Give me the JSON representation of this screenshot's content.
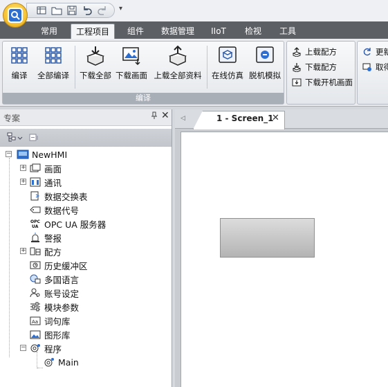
{
  "ribbon_tabs": [
    {
      "label": "常用",
      "active": false
    },
    {
      "label": "工程项目",
      "active": true
    },
    {
      "label": "组件",
      "active": false
    },
    {
      "label": "数据管理",
      "active": false
    },
    {
      "label": "IIoT",
      "active": false
    },
    {
      "label": "检视",
      "active": false
    },
    {
      "label": "工具",
      "active": false
    }
  ],
  "quick_access": {
    "icons": [
      "new-project-icon",
      "open-folder-icon",
      "save-icon",
      "undo-icon",
      "redo-icon",
      "customize-dropdown-icon"
    ]
  },
  "ribbon": {
    "build_group": {
      "label": "编译",
      "buttons": [
        {
          "label": "编译",
          "icon": "compile-icon"
        },
        {
          "label": "全部编译",
          "icon": "compile-all-icon"
        },
        {
          "label": "下载全部",
          "icon": "download-all-icon"
        },
        {
          "label": "下载画面",
          "icon": "download-screen-icon"
        },
        {
          "label": "上载全部资料",
          "icon": "upload-all-icon"
        },
        {
          "label": "在线仿真",
          "icon": "online-simulation-icon"
        },
        {
          "label": "脱机模拟",
          "icon": "offline-simulation-icon"
        }
      ]
    },
    "recipe_group": {
      "buttons": [
        {
          "label": "上载配方",
          "icon": "upload-recipe-icon"
        },
        {
          "label": "下载配方",
          "icon": "download-recipe-icon"
        },
        {
          "label": "下载开机画面",
          "icon": "download-startup-screen-icon"
        }
      ]
    },
    "update_group": {
      "buttons": [
        {
          "label": "更新",
          "icon": "update-icon"
        },
        {
          "label": "取得",
          "icon": "get-icon"
        }
      ]
    }
  },
  "project_panel": {
    "title": "专案",
    "pin": "ㅁ",
    "close": "✕",
    "tree": {
      "root": "NewHMI",
      "items": [
        {
          "label": "画面",
          "icon": "screen-icon",
          "expandable": true
        },
        {
          "label": "通讯",
          "icon": "communication-icon",
          "expandable": true
        },
        {
          "label": "数据交换表",
          "icon": "data-exchange-icon",
          "expandable": false
        },
        {
          "label": "数据代号",
          "icon": "tag-icon",
          "expandable": false
        },
        {
          "label": "OPC UA 服务器",
          "icon": "opc-ua-icon",
          "expandable": false
        },
        {
          "label": "警报",
          "icon": "alarm-icon",
          "expandable": false
        },
        {
          "label": "配方",
          "icon": "recipe-icon",
          "expandable": true
        },
        {
          "label": "历史缓冲区",
          "icon": "history-buffer-icon",
          "expandable": false
        },
        {
          "label": "多国语言",
          "icon": "multilanguage-icon",
          "expandable": false
        },
        {
          "label": "账号设定",
          "icon": "account-icon",
          "expandable": false
        },
        {
          "label": "模块参数",
          "icon": "module-params-icon",
          "expandable": false
        },
        {
          "label": "词句库",
          "icon": "text-library-icon",
          "expandable": false
        },
        {
          "label": "图形库",
          "icon": "graphics-library-icon",
          "expandable": false
        },
        {
          "label": "程序",
          "icon": "program-icon",
          "expandable": true,
          "expanded": true
        }
      ],
      "program_children": [
        {
          "label": "Main",
          "icon": "macro-icon"
        }
      ]
    }
  },
  "document": {
    "tab_label": "1 - Screen_1",
    "tab_close": "✕",
    "scroll_left": "◁"
  },
  "colors": {
    "tabbar": "#5c5f64",
    "ribbon_group_label": "#a9afb7",
    "accent_blue": "#2d6fd1",
    "app_button": "#f5c233"
  }
}
